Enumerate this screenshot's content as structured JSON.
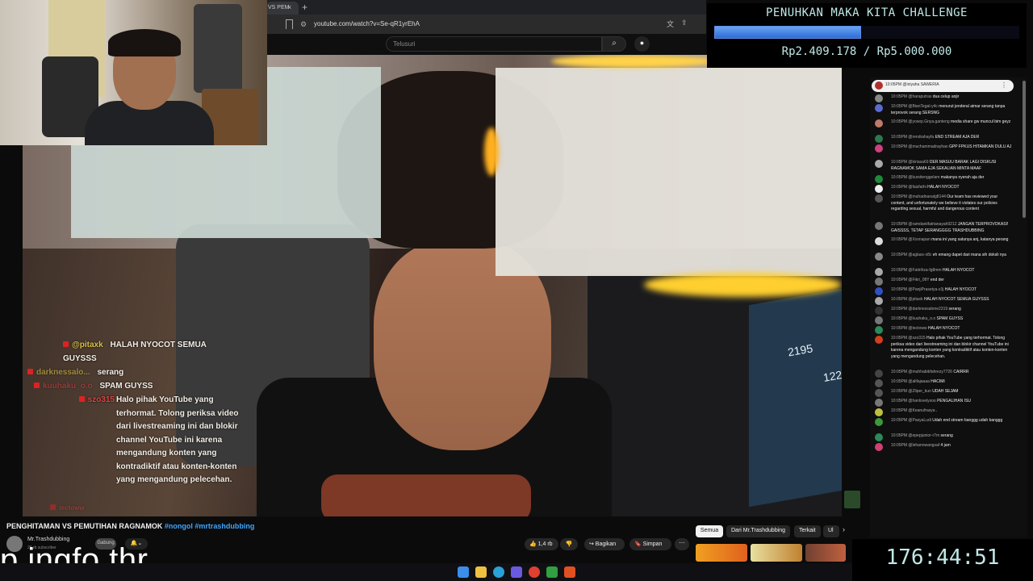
{
  "browser": {
    "tab_label": "VS PEM",
    "tab_close": "×",
    "tab_new": "+",
    "url": "youtube.com/watch?v=Se-qR1yrEhA",
    "search_placeholder": "Telusuri",
    "icons": [
      "bookmark-icon",
      "tune-icon",
      "search-icon",
      "mic-icon",
      "translate-icon",
      "share-icon"
    ]
  },
  "donation": {
    "title": "PENUHKAN MAKA KITA CHALLENGE",
    "amount": "Rp2.409.178 / Rp5.000.000",
    "progress": 0.4818,
    "bar_color": "#2c6cd8"
  },
  "timer": "176:44:51",
  "chat_top": {
    "text": "10:05PM  @iniyaha  SAWERIA",
    "menu": "⋮"
  },
  "chat_messages": [
    {
      "time": "10:05PM",
      "author": "@haraputras",
      "text": "dua celup anjir",
      "color": "#888"
    },
    {
      "time": "10:05PM",
      "author": "@BianTegal-y4c",
      "text": "menurut jenderal aimar serang tanpa terprovok serang SERSNG",
      "color": "#5a6ad0"
    },
    {
      "time": "10:05PM",
      "author": "@yosep.Gnya.ganteng",
      "text": "media share gw muncul bim geyz",
      "color": "#c07a6a"
    },
    {
      "time": "10:05PM",
      "author": "@rendrahayfa",
      "text": "END STREAM AJA DER",
      "color": "#2a7a4a"
    },
    {
      "time": "10:05PM",
      "author": "@muchammadrayhan",
      "text": "GPP FPKUS HITAMKAN DULU AJ",
      "color": "#d04080"
    },
    {
      "time": "10:05PM",
      "author": "@kiriasa69",
      "text": "DER MASUU BARAK LAGI DISKUSI RAGNAMOK SAMA EJA SEKALIAN MINTA MAAF",
      "color": "#aaa"
    },
    {
      "time": "10:05PM",
      "author": "@kursitenggelam",
      "text": "makanya nyerah aja der",
      "color": "#1e8a3a"
    },
    {
      "time": "10:05PM",
      "author": "@faizfathi",
      "text": "HALAH NYOCOT",
      "color": "#eee"
    },
    {
      "time": "10:05PM",
      "author": "@muhadnanalg8144",
      "text": "Our team has reviewed your content, and unfortunately we believe it violates our policies regarding sexual, harmful and dangerous content",
      "color": "#555"
    },
    {
      "time": "10:05PM",
      "author": "@ramdaniifatrianayah9212",
      "text": "JANGAN TERPROVOKASI! GAISSSS, TETAP SERANGGGG TRASHDUBBING",
      "color": "#777"
    },
    {
      "time": "10:05PM",
      "author": "@Xxxnapan",
      "text": "mana ini yang satunya anj, katanya perang",
      "color": "#ddd"
    },
    {
      "time": "10:05PM",
      "author": "@aglass-x8c",
      "text": "eh emang dapet dari mana sih doksli nya",
      "color": "#888"
    },
    {
      "time": "10:05PM",
      "author": "@Fatirihza-fg8mm",
      "text": "HALAH NYOCOT",
      "color": "#aaa"
    },
    {
      "time": "10:05PM",
      "author": "@Fikri_08Y",
      "text": "end der",
      "color": "#777"
    },
    {
      "time": "10:05PM",
      "author": "@PanjiPrasetya-z3j",
      "text": "HALAH NYOCOT",
      "color": "#3050c0"
    },
    {
      "time": "10:05PM",
      "author": "@pitaxk",
      "text": "HALAH NYOCOT SEMUA GUYSSS",
      "color": "#aaa"
    },
    {
      "time": "10:05PM",
      "author": "@darknessalone2319",
      "text": "serang",
      "color": "#333"
    },
    {
      "time": "10:05PM",
      "author": "@kuuhaku_o.o",
      "text": "SPAM GUYSS",
      "color": "#777"
    },
    {
      "time": "10:05PM",
      "author": "@tectoww",
      "text": "HALAH NYOCOT",
      "color": "#2a8a5a"
    },
    {
      "time": "10:05PM",
      "author": "@szo315",
      "text": "Halo pihak YouTube yang terhormat. Tolong periksa video dari livestreaming ini dan blokir channel YouTube ini karena mengandung konten yang kontradiktif atau konten-konten yang mengandung pelecehan.",
      "color": "#d0401a"
    },
    {
      "time": "10:05PM",
      "author": "@muhhabibfahrezy7726",
      "text": "CAIRRR",
      "color": "#444"
    },
    {
      "time": "10:05PM",
      "author": "@alifajaaaa",
      "text": "HACIMI",
      "color": "#555"
    },
    {
      "time": "10:05PM",
      "author": "@Zliper_kun",
      "text": "UDAH SEJAM",
      "color": "#555"
    },
    {
      "time": "10:05PM",
      "author": "@hanlovelyxoo",
      "text": "PENGALIHAN ISU",
      "color": "#777"
    },
    {
      "time": "10:05PM",
      "author": "@Keanufrasya",
      "text": ".",
      "color": "#c0c040"
    },
    {
      "time": "10:05PM",
      "author": "@PasyaLudi",
      "text": "Udah end stream banggg udah banggg",
      "color": "#3a9a3a"
    },
    {
      "time": "10:05PM",
      "author": "@epepjunior-r7m",
      "text": "serang",
      "color": "#2a8a5a"
    },
    {
      "time": "10:05PM",
      "author": "@lehannwangsaf",
      "text": "4 jam",
      "color": "#d04070"
    }
  ],
  "video_overlay": [
    {
      "name": "@pitaxk",
      "text": "HALAH NYOCOT SEMUA GUYSSS"
    },
    {
      "name": "darknessalo...",
      "text": "serang"
    },
    {
      "name": "kuuhaku_o.o",
      "text": "SPAM GUYSS"
    },
    {
      "name": "szo315",
      "text": "Halo pihak YouTube yang terhormat. Tolong periksa video dari livestreaming ini dan blokir channel YouTube ini karena mengandung konten yang kontradiktif atau konten-konten yang mengandung pelecehan."
    },
    {
      "name": "tectoww",
      "text": ""
    }
  ],
  "monitor": {
    "num1": "2195",
    "num2": "122"
  },
  "video": {
    "title": "PENGHITAMAN VS PEMUTIHAN RAGNAMOK",
    "tag1": "#nongol",
    "tag2": "#mrtrashdubbing",
    "channel": "Mr.Trashdubbing",
    "channel_sub": "26 rb subscriber",
    "join": "Gabung",
    "bell": "🔔⌄",
    "like": "👍 1,4 rb",
    "dislike": "👎",
    "share": "↪ Bagikan",
    "save": "🔖 Simpan",
    "more": "⋯"
  },
  "categories": {
    "all": "Semua",
    "from": "Dari Mr.Trashdubbing",
    "related": "Terkait",
    "cut": "Ul",
    "next": "›"
  },
  "caption": "p ingfo thr"
}
